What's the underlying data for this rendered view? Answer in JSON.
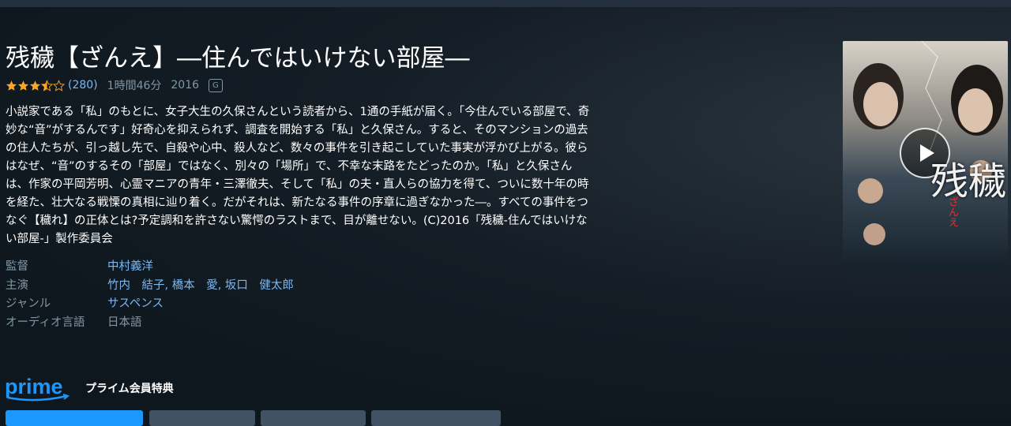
{
  "title": "残穢【ざんえ】―住んではいけない部屋―",
  "meta": {
    "rating_stars": 3.5,
    "rating_count": "(280)",
    "runtime": "1時間46分",
    "year": "2016",
    "age_rating": "G"
  },
  "synopsis": "小説家である「私」のもとに、女子大生の久保さんという読者から、1通の手紙が届く。「今住んでいる部屋で、奇妙な“音”がするんです」好奇心を抑えられず、調査を開始する「私」と久保さん。すると、そのマンションの過去の住人たちが、引っ越し先で、自殺や心中、殺人など、数々の事件を引き起こしていた事実が浮かび上がる。彼らはなぜ、“音”のするその「部屋」ではなく、別々の「場所」で、不幸な末路をたどったのか。「私」と久保さんは、作家の平岡芳明、心霊マニアの青年・三澤徹夫、そして「私」の夫・直人らの協力を得て、ついに数十年の時を経た、壮大なる戦慄の真相に辿り着く。だがそれは、新たなる事件の序章に過ぎなかった―。すべての事件をつなぐ【穢れ】の正体とは?予定調和を許さない驚愕のラストまで、目が離せない。(C)2016「残穢-住んではいけない部屋-」製作委員会",
  "details": {
    "director_label": "監督",
    "director": "中村義洋",
    "cast_label": "主演",
    "cast": "竹内　結子, 橋本　愛, 坂口　健太郎",
    "genre_label": "ジャンル",
    "genre": "サスペンス",
    "audio_label": "オーディオ言語",
    "audio": "日本語"
  },
  "prime": {
    "logo_text": "prime",
    "benefit_label": "プライム会員特典"
  },
  "poster": {
    "title_text": "残穢",
    "sub_text": "ざんえ"
  },
  "colors": {
    "background": "#0f171e",
    "accent": "#1a98ff",
    "link": "#79b8f3",
    "muted": "#8197a4",
    "star": "#ffa724"
  }
}
